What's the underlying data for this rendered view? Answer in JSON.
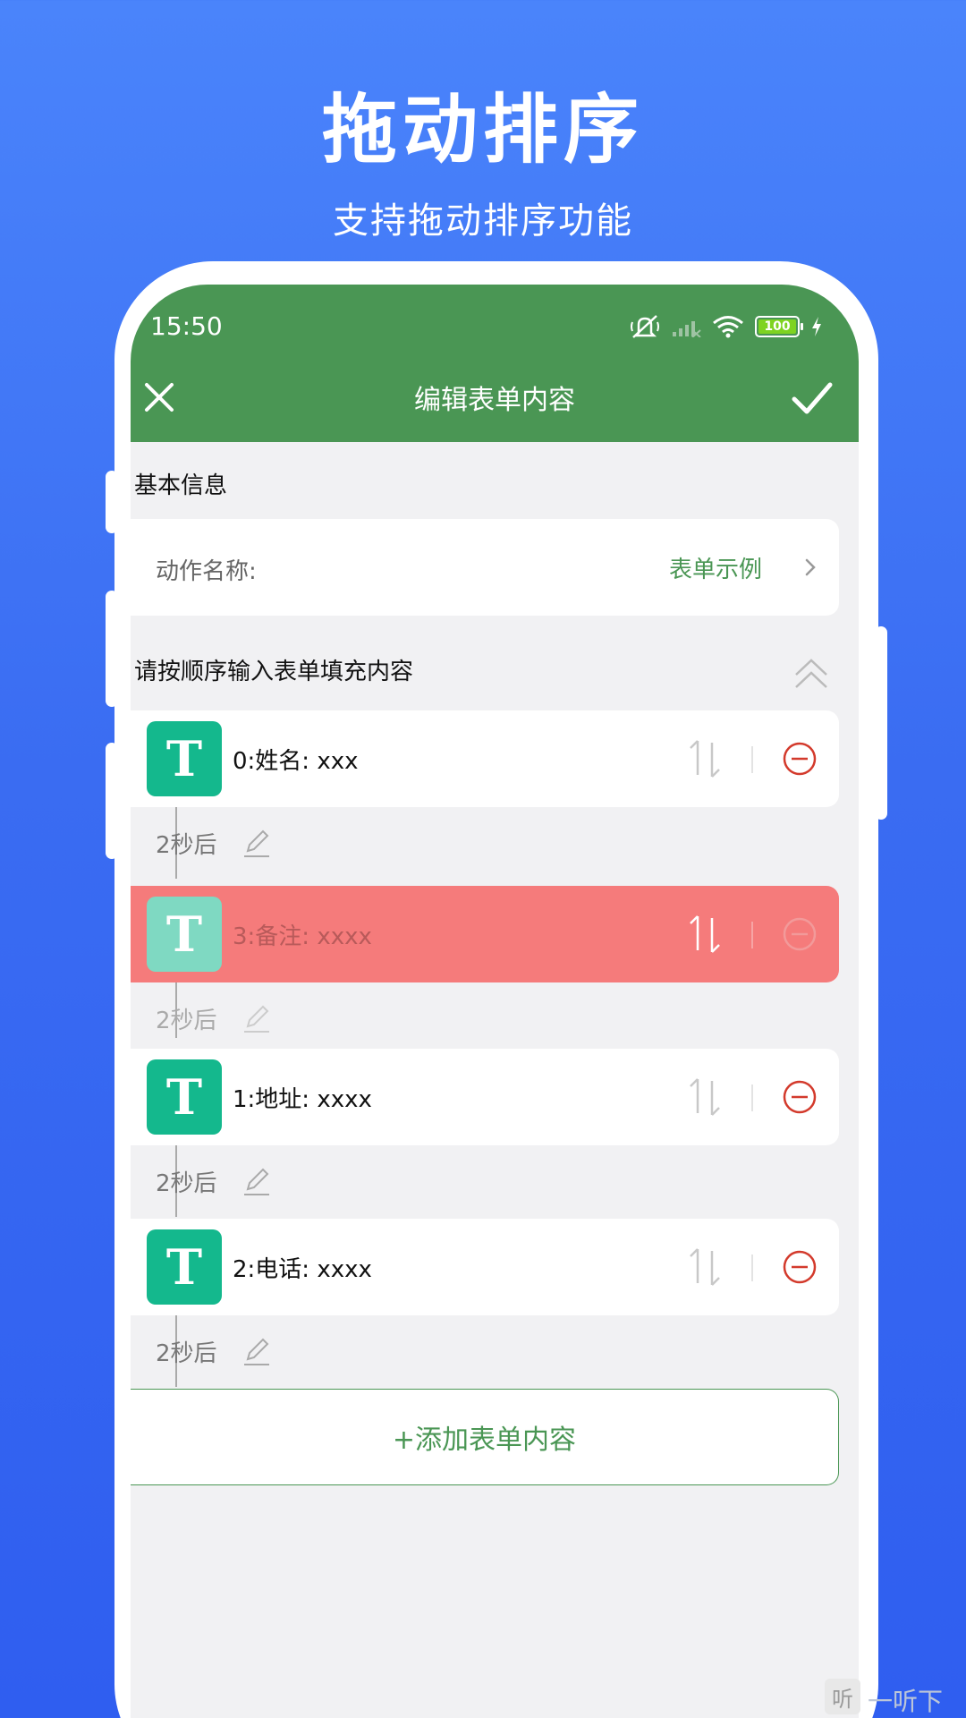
{
  "promo": {
    "title": "拖动排序",
    "subtitle": "支持拖动排序功能"
  },
  "status_bar": {
    "time": "15:50",
    "battery": "100"
  },
  "app_bar": {
    "title": "编辑表单内容",
    "close_icon": "close-icon",
    "confirm_icon": "check-icon",
    "background": "#4a9654"
  },
  "basic_info": {
    "section_title": "基本信息",
    "action_name_label": "动作名称:",
    "action_name_value": "表单示例"
  },
  "form_section": {
    "title": "请按顺序输入表单填充内容",
    "items": [
      {
        "icon": "T",
        "text": "0:姓名:  xxx",
        "delay": "2秒后",
        "dragging": false
      },
      {
        "icon": "T",
        "text": "3:备注:  xxxx",
        "delay": "2秒后",
        "dragging": true
      },
      {
        "icon": "T",
        "text": "1:地址:  xxxx",
        "delay": "2秒后",
        "dragging": false
      },
      {
        "icon": "T",
        "text": "2:电话:  xxxx",
        "delay": "2秒后",
        "dragging": false
      }
    ],
    "add_button": "+添加表单内容"
  },
  "colors": {
    "accent_green": "#4a9654",
    "t_icon": "#14b88d",
    "drag_highlight": "#f57b7b",
    "remove_red": "#d33a2c"
  },
  "watermark": {
    "glyph": "听",
    "text": "一听下载"
  }
}
